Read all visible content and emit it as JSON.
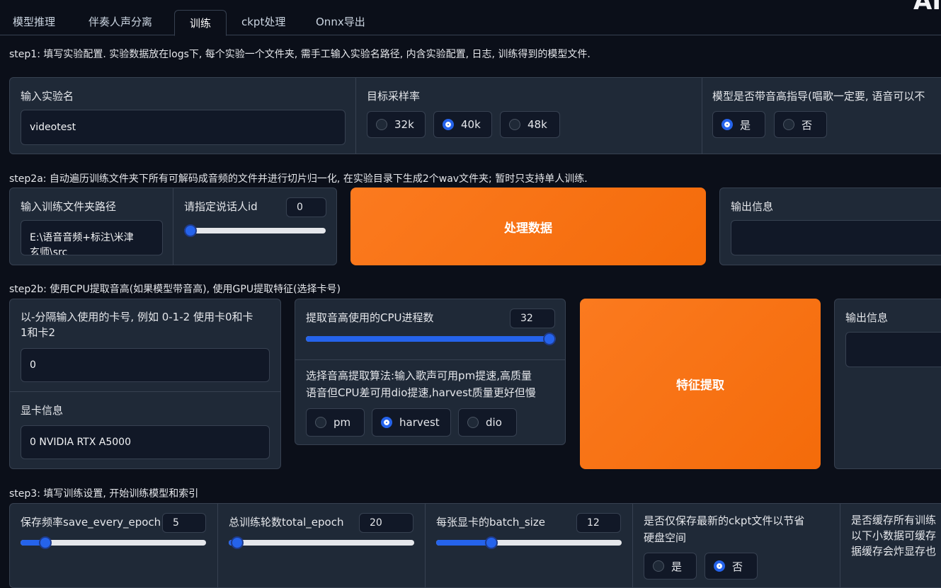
{
  "tabs": [
    "模型推理",
    "伴奏人声分离",
    "训练",
    "ckpt处理",
    "Onnx导出"
  ],
  "brand": "AI",
  "step1": {
    "desc": "step1: 填写实验配置. 实验数据放在logs下, 每个实验一个文件夹, 需手工输入实验名路径, 内含实验配置, 日志, 训练得到的模型文件.",
    "exp_label": "输入实验名",
    "exp_value": "videotest",
    "sr_label": "目标采样率",
    "sr_options": [
      "32k",
      "40k",
      "48k"
    ],
    "sr_selected": "40k",
    "f0_label": "模型是否带音高指导(唱歌一定要, 语音可以不",
    "f0_options": [
      "是",
      "否"
    ],
    "f0_selected": "是"
  },
  "step2a": {
    "desc": "step2a: 自动遍历训练文件夹下所有可解码成音频的文件并进行切片归一化, 在实验目录下生成2个wav文件夹; 暂时只支持单人训练.",
    "dir_label": "输入训练文件夹路径",
    "dir_value_line1": "E:\\语音音频+标注\\米津",
    "dir_value_line2": "玄师\\src",
    "spk_label": "请指定说话人id",
    "spk_value": "0",
    "spk_fraction": 0.0,
    "button": "处理数据",
    "output_label": "输出信息"
  },
  "step2b": {
    "desc": "step2b: 使用CPU提取音高(如果模型带音高), 使用GPU提取特征(选择卡号)",
    "gpus_label_line1": "以-分隔输入使用的卡号, 例如 0-1-2 使用卡0和卡",
    "gpus_label_line2": "1和卡2",
    "gpus_value": "0",
    "gpu_info_label": "显卡信息",
    "gpu_info_value": "0 NVIDIA RTX A5000",
    "cpu_label": "提取音高使用的CPU进程数",
    "cpu_value": "32",
    "cpu_fraction": 1.0,
    "algo_label_line1": "选择音高提取算法:输入歌声可用pm提速,高质量",
    "algo_label_line2": "语音但CPU差可用dio提速,harvest质量更好但慢",
    "algo_options": [
      "pm",
      "harvest",
      "dio"
    ],
    "algo_selected": "harvest",
    "button": "特征提取",
    "output_label": "输出信息"
  },
  "step3": {
    "desc": "step3: 填写训练设置, 开始训练模型和索引",
    "save_label": "保存频率save_every_epoch",
    "save_value": "5",
    "save_fraction": 0.1,
    "total_label": "总训练轮数total_epoch",
    "total_value": "20",
    "total_fraction": 0.03,
    "batch_label": "每张显卡的batch_size",
    "batch_value": "12",
    "batch_fraction": 0.3,
    "latest_label_line1": "是否仅保存最新的ckpt文件以节省",
    "latest_label_line2": "硬盘空间",
    "latest_options": [
      "是",
      "否"
    ],
    "latest_selected": "否",
    "cache_label_line1": "是否缓存所有训练",
    "cache_label_line2": "以下小数据可缓存",
    "cache_label_line3": "据缓存会炸显存也"
  }
}
